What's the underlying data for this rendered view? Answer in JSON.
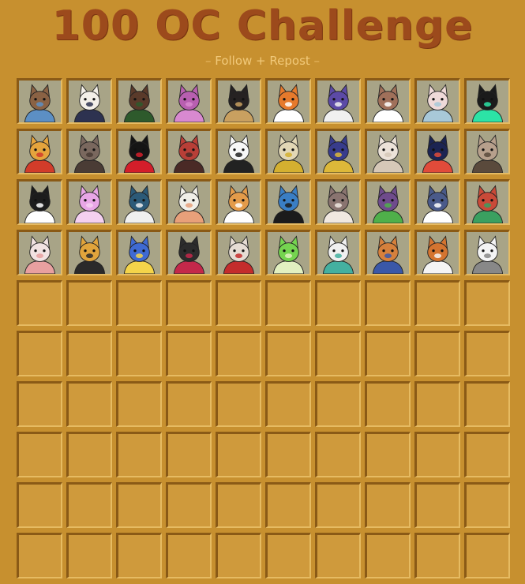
{
  "title": "100 OC Challenge",
  "subtitle": "Follow + Repost",
  "grid": {
    "rows": 10,
    "cols": 10,
    "filled_count": 40,
    "characters": [
      {
        "head": "#8a6244",
        "accent": "#5c8fc4"
      },
      {
        "head": "#f3efe8",
        "accent": "#2d3250"
      },
      {
        "head": "#5a3a2a",
        "accent": "#2e5a2c"
      },
      {
        "head": "#b85fb0",
        "accent": "#d889d0"
      },
      {
        "head": "#262222",
        "accent": "#c9a060"
      },
      {
        "head": "#e67a2c",
        "accent": "#ffffff"
      },
      {
        "head": "#5c4aa6",
        "accent": "#f0f0f0"
      },
      {
        "head": "#a0705a",
        "accent": "#ffffff"
      },
      {
        "head": "#efd9d8",
        "accent": "#a8c8d8"
      },
      {
        "head": "#1b1b1b",
        "accent": "#2ce3a6"
      },
      {
        "head": "#e5a43d",
        "accent": "#d23c2a"
      },
      {
        "head": "#7a685e",
        "accent": "#4a3c35"
      },
      {
        "head": "#151515",
        "accent": "#d41e2a"
      },
      {
        "head": "#b83f37",
        "accent": "#4a2a26"
      },
      {
        "head": "#f7f7f7",
        "accent": "#222222"
      },
      {
        "head": "#e2d7b5",
        "accent": "#d4b030"
      },
      {
        "head": "#383c8c",
        "accent": "#ddb839"
      },
      {
        "head": "#ece2d8",
        "accent": "#d6c8b8"
      },
      {
        "head": "#1c2452",
        "accent": "#e14b3a"
      },
      {
        "head": "#b7a08c",
        "accent": "#5a4a3c"
      },
      {
        "head": "#1c1c1c",
        "accent": "#ffffff"
      },
      {
        "head": "#e8a6e6",
        "accent": "#f4d0f0"
      },
      {
        "head": "#2c5a78",
        "accent": "#f0f0f0"
      },
      {
        "head": "#f1efe8",
        "accent": "#e8a07a"
      },
      {
        "head": "#e39b4a",
        "accent": "#ffffff"
      },
      {
        "head": "#3a7ec4",
        "accent": "#1b1b1b"
      },
      {
        "head": "#8a7470",
        "accent": "#f0e8e0"
      },
      {
        "head": "#6f4b8c",
        "accent": "#4fb04a"
      },
      {
        "head": "#4a5a8a",
        "accent": "#ffffff"
      },
      {
        "head": "#c94a38",
        "accent": "#3aa060"
      },
      {
        "head": "#f1e2e2",
        "accent": "#e8a0a0"
      },
      {
        "head": "#e1a43c",
        "accent": "#2a2a2a"
      },
      {
        "head": "#3f6ad2",
        "accent": "#f4d44a"
      },
      {
        "head": "#2c2c2c",
        "accent": "#c4284a"
      },
      {
        "head": "#e6dcd4",
        "accent": "#c42c2c"
      },
      {
        "head": "#75d450",
        "accent": "#e2f0c0"
      },
      {
        "head": "#f0f0f0",
        "accent": "#44b0a0"
      },
      {
        "head": "#d6803c",
        "accent": "#3a58a8"
      },
      {
        "head": "#d47430",
        "accent": "#f4f4f4"
      },
      {
        "head": "#f4f4f4",
        "accent": "#888888"
      }
    ]
  }
}
